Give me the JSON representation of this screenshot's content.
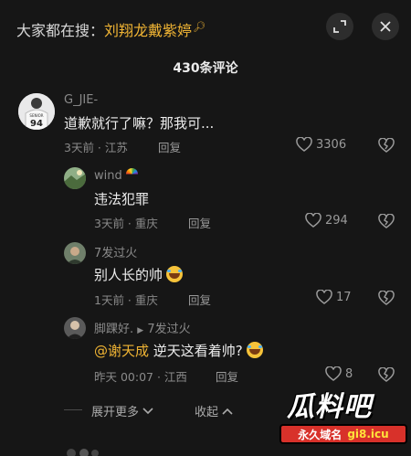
{
  "search_hint": {
    "prefix": "大家都在搜：",
    "keyword": "刘翔龙戴紫婷"
  },
  "comment_count": "430条评论",
  "comments": [
    {
      "user": "G_JIE-",
      "text": "道歉就行了嘛？那我可...",
      "meta": "3天前 · 江苏",
      "reply": "回复",
      "likes": "3306",
      "avatar_number": "94",
      "avatar_caption": "SENIOR"
    },
    {
      "user": "wind",
      "text": "违法犯罪",
      "meta": "3天前 · 重庆",
      "reply": "回复",
      "likes": "294"
    },
    {
      "user": "7发过火",
      "text": "别人长的帅",
      "meta": "1天前 · 重庆",
      "reply": "回复",
      "likes": "17"
    },
    {
      "user": "脚踝好.",
      "reply_to": "7发过火",
      "mention": "@谢天成",
      "text": " 逆天这看着帅?",
      "meta": "昨天 00:07 · 江西",
      "reply": "回复",
      "likes": "8"
    }
  ],
  "expand_more": "展开更多",
  "collapse": "收起",
  "watermark": {
    "title": "瓜料吧",
    "left": "永久域名",
    "right": "gi8.icu"
  },
  "colors": {
    "background": "#161616",
    "accent": "#f1b534",
    "watermark_red": "#d8312a"
  },
  "icons": [
    "expand-icon",
    "close-icon",
    "heart-icon",
    "broken-heart-icon",
    "chevron-down-icon",
    "chevron-up-icon",
    "rainbow-emoji-icon",
    "laughing-emoji-icon"
  ]
}
